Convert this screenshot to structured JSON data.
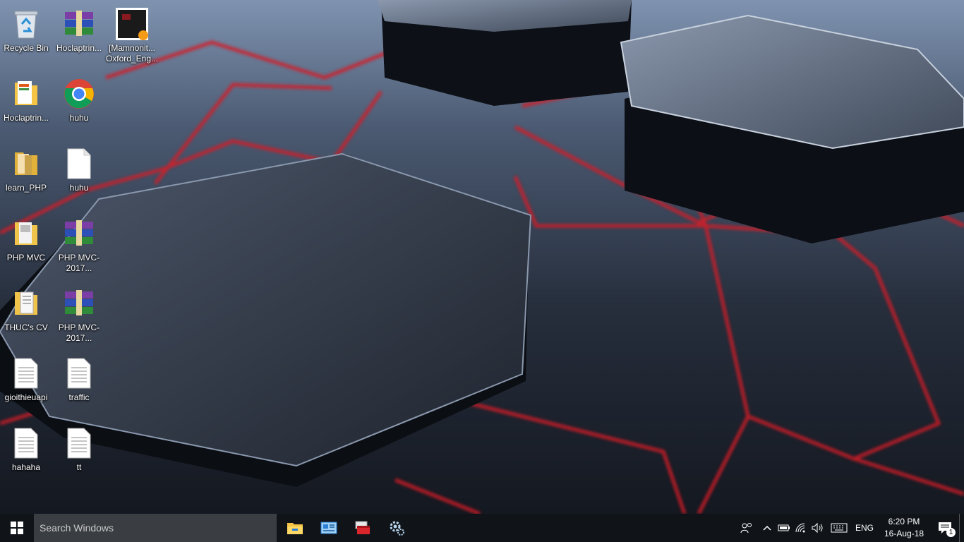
{
  "desktop": {
    "icons": [
      {
        "label": "Recycle Bin",
        "icon": "recycle-bin-icon"
      },
      {
        "label": "Hoclaptrin...",
        "icon": "winrar-archive-icon"
      },
      {
        "label": "[Mamnonit... Oxford_Eng...",
        "icon": "image-file-icon"
      },
      {
        "label": "Hoclaptrin...",
        "icon": "folder-icon"
      },
      {
        "label": "huhu",
        "icon": "chrome-icon"
      },
      {
        "label": "learn_PHP",
        "icon": "folder-icon"
      },
      {
        "label": "huhu",
        "icon": "blank-file-icon"
      },
      {
        "label": "PHP MVC",
        "icon": "folder-icon"
      },
      {
        "label": "PHP MVC-2017...",
        "icon": "winrar-archive-icon"
      },
      {
        "label": "THUC's CV",
        "icon": "folder-icon"
      },
      {
        "label": "PHP MVC-2017...",
        "icon": "winrar-archive-icon"
      },
      {
        "label": "gioithieuapi",
        "icon": "text-file-icon"
      },
      {
        "label": "traffic",
        "icon": "text-file-icon"
      },
      {
        "label": "hahaha",
        "icon": "text-file-icon"
      },
      {
        "label": "tt",
        "icon": "text-file-icon"
      }
    ]
  },
  "taskbar": {
    "search_placeholder": "Search Windows",
    "apps": [
      "file-explorer-icon",
      "control-panel-icon",
      "toolbox-icon",
      "settings-gear-icon"
    ],
    "tray": {
      "language": "ENG",
      "time": "6:20 PM",
      "date": "16-Aug-18",
      "notification_count": "1"
    }
  },
  "colors": {
    "accent_red": "#e0232b",
    "taskbar": "#101419",
    "search_box": "#3a3d41"
  }
}
